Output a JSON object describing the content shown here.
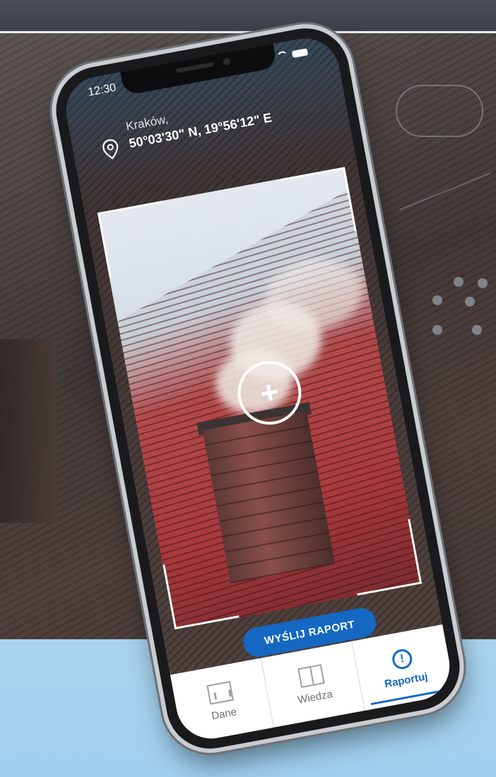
{
  "status_bar": {
    "time": "12:30"
  },
  "location": {
    "city": "Kraków,",
    "coordinates": "50°03'30\" N, 19°56'12\" E",
    "icon": "location-pin-icon"
  },
  "camera": {
    "action_icon": "add-crosshair-icon"
  },
  "actions": {
    "send_report": "WYŚLIJ RAPORT"
  },
  "tabs": [
    {
      "label": "Dane",
      "icon": "chart-board-icon"
    },
    {
      "label": "Wiedza",
      "icon": "book-icon"
    },
    {
      "label": "Raportuj",
      "icon": "alert-bulb-icon",
      "active": true
    }
  ],
  "colors": {
    "accent": "#1468c2"
  }
}
